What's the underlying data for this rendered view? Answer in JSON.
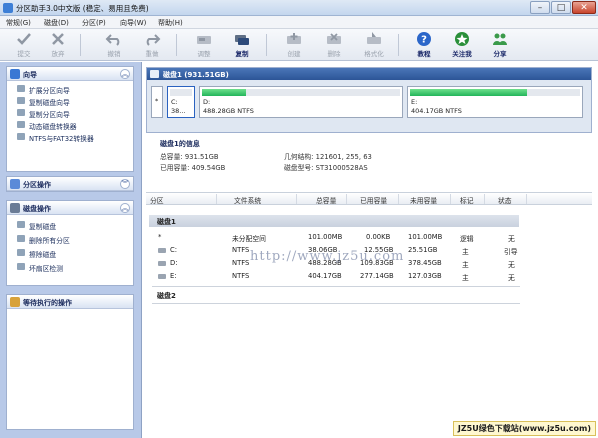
{
  "window": {
    "title": "分区助手3.0中文版 (稳定、易用且免费)",
    "min_glyph": "–",
    "max_glyph": "□",
    "close_glyph": "✕"
  },
  "menu": [
    "常规(G)",
    "磁盘(D)",
    "分区(P)",
    "向导(W)",
    "帮助(H)"
  ],
  "toolbar": {
    "items": [
      {
        "label": "提交",
        "icon": "check-icon",
        "state": "disabled"
      },
      {
        "label": "放弃",
        "icon": "discard-x-icon",
        "state": "disabled"
      },
      {
        "label": "撤销",
        "icon": "undo-icon",
        "state": "disabled"
      },
      {
        "label": "重做",
        "icon": "redo-icon",
        "state": "disabled"
      },
      {
        "label": "调整",
        "icon": "resize-disk-icon",
        "state": "disabled"
      },
      {
        "label": "复制",
        "icon": "copy-disk-icon",
        "state": "enabled"
      },
      {
        "label": "创建",
        "icon": "create-partition-icon",
        "state": "disabled"
      },
      {
        "label": "删除",
        "icon": "delete-partition-icon",
        "state": "disabled"
      },
      {
        "label": "格式化",
        "icon": "format-icon",
        "state": "disabled"
      },
      {
        "label": "教程",
        "icon": "help-question-icon",
        "state": "enabled"
      },
      {
        "label": "关注我",
        "icon": "follow-star-icon",
        "state": "enabled"
      },
      {
        "label": "分享",
        "icon": "share-people-icon",
        "state": "enabled"
      }
    ]
  },
  "sidebar": {
    "wizard": {
      "title": "向导",
      "items": [
        "扩展分区向导",
        "复制磁盘向导",
        "复制分区向导",
        "动态磁盘转换器",
        "NTFS与FAT32转换器"
      ]
    },
    "partition_ops": {
      "title": "分区操作"
    },
    "disk_ops": {
      "title": "磁盘操作",
      "items": [
        "复制磁盘",
        "删除所有分区",
        "擦除磁盘",
        "坏扇区检测"
      ]
    },
    "pending": {
      "title": "等待执行的操作"
    }
  },
  "disk_map": {
    "header": "磁盘1 (931.51GB)",
    "tiles": [
      {
        "letter": "*",
        "line1": "C:",
        "line2": "38...",
        "used_fraction": 0.0
      },
      {
        "letter": "D:",
        "line1": "D:",
        "line2": "488.28GB NTFS",
        "used_fraction": 0.22
      },
      {
        "letter": "E:",
        "line1": "E:",
        "line2": "404.17GB NTFS",
        "used_fraction": 0.69
      }
    ]
  },
  "disk_info": {
    "heading": "磁盘1的信息",
    "total": "总容量:  931.51GB",
    "used": "已用容量:  409.54GB",
    "geometry": "几何结构:  121601, 255, 63",
    "model": "磁盘型号:  ST31000528AS"
  },
  "table": {
    "columns": [
      "分区",
      "文件系统",
      "总容量",
      "已用容量",
      "未用容量",
      "标记",
      "状态"
    ],
    "groups": [
      {
        "name": "磁盘1",
        "rows": [
          {
            "part": "*",
            "fs": "未分配空间",
            "total": "101.00MB",
            "used": "0.00KB",
            "free": "101.00MB",
            "flag": "逻辑",
            "status": "无"
          },
          {
            "part": "C:",
            "fs": "NTFS",
            "total": "38.06GB",
            "used": "12.55GB",
            "free": "25.51GB",
            "flag": "主",
            "status": "引导"
          },
          {
            "part": "D:",
            "fs": "NTFS",
            "total": "488.28GB",
            "used": "109.83GB",
            "free": "378.45GB",
            "flag": "主",
            "status": "无"
          },
          {
            "part": "E:",
            "fs": "NTFS",
            "total": "404.17GB",
            "used": "277.14GB",
            "free": "127.03GB",
            "flag": "主",
            "status": "无"
          }
        ]
      },
      {
        "name": "磁盘2",
        "rows": []
      }
    ]
  },
  "watermark": "http://www.jz5u.com",
  "credit": "JZ5U绿色下载站(www.jz5u.com)"
}
